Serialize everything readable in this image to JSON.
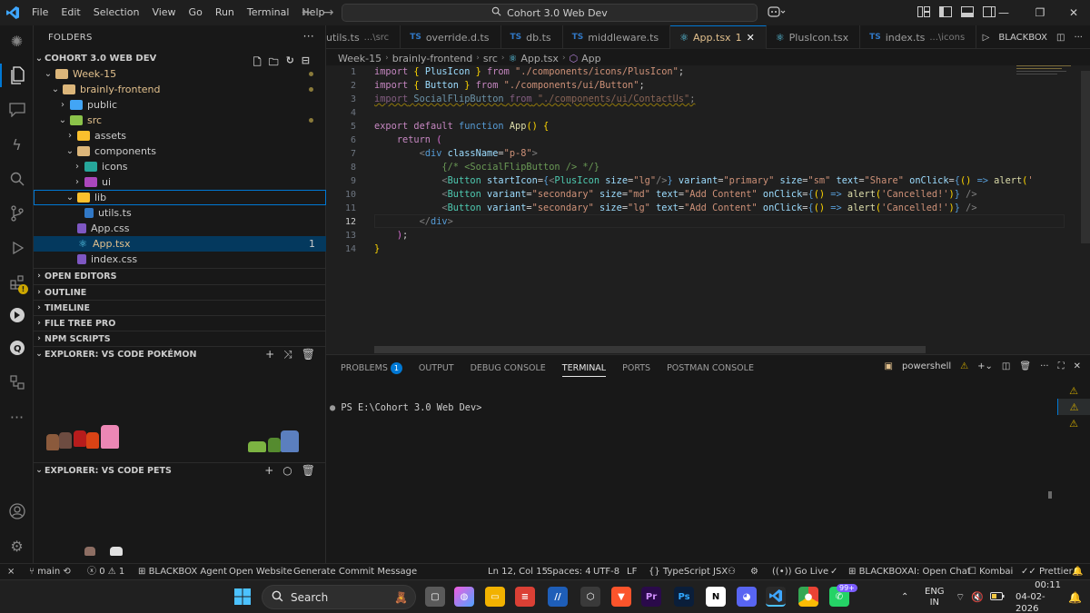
{
  "titlebar": {
    "menu": [
      "File",
      "Edit",
      "Selection",
      "View",
      "Go",
      "Run",
      "Terminal",
      "Help"
    ],
    "search_text": "Cohort 3.0 Web Dev"
  },
  "sidebar": {
    "header": "FOLDERS",
    "tree": [
      {
        "label": "COHORT 3.0 WEB DEV"
      },
      {
        "label": "Week-15"
      },
      {
        "label": "brainly-frontend"
      },
      {
        "label": "public"
      },
      {
        "label": "src"
      },
      {
        "label": "assets"
      },
      {
        "label": "components"
      },
      {
        "label": "icons"
      },
      {
        "label": "ui"
      },
      {
        "label": "lib"
      },
      {
        "label": "utils.ts"
      },
      {
        "label": "App.css"
      },
      {
        "label": "App.tsx",
        "badge": "1"
      },
      {
        "label": "index.css"
      }
    ],
    "sections": [
      "OPEN EDITORS",
      "OUTLINE",
      "TIMELINE",
      "FILE TREE PRO",
      "NPM SCRIPTS",
      "EXPLORER: VS CODE POKÉMON",
      "EXPLORER: VS CODE PETS"
    ]
  },
  "tabs": [
    {
      "label": "utils.ts",
      "path": "...\\src",
      "icon": "ts"
    },
    {
      "label": "override.d.ts",
      "path": "",
      "icon": "ts"
    },
    {
      "label": "db.ts",
      "path": "",
      "icon": "ts"
    },
    {
      "label": "middleware.ts",
      "path": "",
      "icon": "ts"
    },
    {
      "label": "App.tsx",
      "path": "",
      "icon": "react",
      "modified": "1",
      "active": true
    },
    {
      "label": "PlusIcon.tsx",
      "path": "",
      "icon": "react"
    },
    {
      "label": "index.ts",
      "path": "...\\icons",
      "icon": "ts"
    }
  ],
  "tab_right": {
    "blackbox": "BLACKBOX"
  },
  "breadcrumb": [
    "Week-15",
    "brainly-frontend",
    "src",
    "App.tsx",
    "App"
  ],
  "editor": {
    "line_numbers": [
      "1",
      "2",
      "3",
      "4",
      "5",
      "6",
      "7",
      "8",
      "9",
      "10",
      "11",
      "12",
      "13",
      "14"
    ],
    "current_line": "12"
  },
  "panel": {
    "tabs": [
      "PROBLEMS",
      "OUTPUT",
      "DEBUG CONSOLE",
      "TERMINAL",
      "PORTS",
      "POSTMAN CONSOLE"
    ],
    "problems_count": "1",
    "shell": "powershell",
    "prompt": "PS E:\\Cohort 3.0  Web Dev>"
  },
  "statusbar": {
    "branch": "main",
    "errors": "0",
    "warnings": "1",
    "blackbox_agent": "BLACKBOX Agent",
    "open_website": "Open Website",
    "commit_message": "Generate Commit Message",
    "position": "Ln 12, Col 15",
    "spaces": "Spaces: 4",
    "encoding": "UTF-8",
    "eol": "LF",
    "language": "TypeScript JSX",
    "golive": "Go Live",
    "blackbox_chat": "BLACKBOXAI: Open Chat",
    "kombai": "Kombai",
    "prettier": "Prettier"
  },
  "taskbar": {
    "search": "Search",
    "lang1": "ENG",
    "lang2": "IN",
    "time": "00:11",
    "date": "04-02-2026",
    "notif": "99+"
  },
  "colors": {
    "accent": "#0078d4",
    "warning": "#cca700",
    "selection": "#04395e"
  }
}
